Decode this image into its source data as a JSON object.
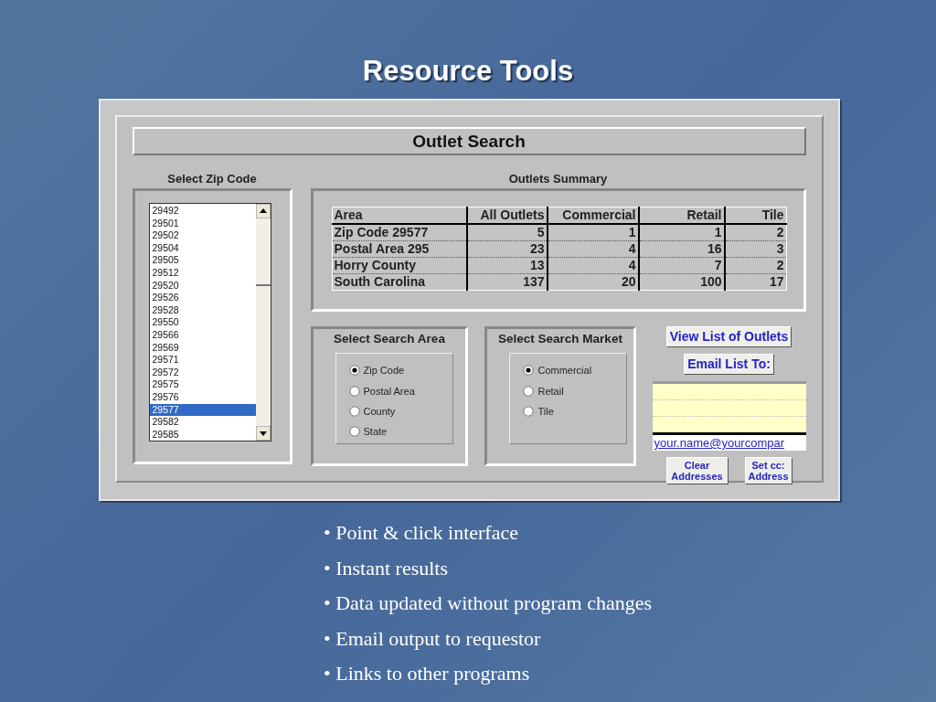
{
  "slide_title": "Resource Tools",
  "form": {
    "title": "Outlet Search",
    "zip_list": {
      "label": "Select Zip Code",
      "items": [
        {
          "text": "29492",
          "selected": false
        },
        {
          "text": "29501",
          "selected": false
        },
        {
          "text": "29502",
          "selected": false
        },
        {
          "text": "29504",
          "selected": false
        },
        {
          "text": "29505",
          "selected": false
        },
        {
          "text": "29512",
          "selected": false
        },
        {
          "text": "29520",
          "selected": false
        },
        {
          "text": "29526",
          "selected": false
        },
        {
          "text": "29528",
          "selected": false
        },
        {
          "text": "29550",
          "selected": false
        },
        {
          "text": "29566",
          "selected": false
        },
        {
          "text": "29569",
          "selected": false
        },
        {
          "text": "29571",
          "selected": false
        },
        {
          "text": "29572",
          "selected": false
        },
        {
          "text": "29575",
          "selected": false
        },
        {
          "text": "29576",
          "selected": false
        },
        {
          "text": "29577",
          "selected": true
        },
        {
          "text": "29582",
          "selected": false
        },
        {
          "text": "29585",
          "selected": false
        }
      ]
    },
    "summary": {
      "label": "Outlets Summary",
      "columns": [
        "Area",
        "All Outlets",
        "Commercial",
        "Retail",
        "Tile"
      ],
      "rows": [
        [
          "Zip Code 29577",
          "5",
          "1",
          "1",
          "2"
        ],
        [
          "Postal Area 295",
          "23",
          "4",
          "16",
          "3"
        ],
        [
          "Horry County",
          "13",
          "4",
          "7",
          "2"
        ],
        [
          "South Carolina",
          "137",
          "20",
          "100",
          "17"
        ]
      ]
    },
    "search_area": {
      "label": "Select Search Area",
      "options": [
        {
          "label": "Zip Code",
          "selected": true
        },
        {
          "label": "Postal Area",
          "selected": false
        },
        {
          "label": "County",
          "selected": false
        },
        {
          "label": "State",
          "selected": false
        }
      ]
    },
    "search_market": {
      "label": "Select Search Market",
      "options": [
        {
          "label": "Commercial",
          "selected": true
        },
        {
          "label": "Retail",
          "selected": false
        },
        {
          "label": "Tile",
          "selected": false
        }
      ]
    },
    "view_button": "View List of Outlets",
    "email_button": "Email List To:",
    "email_value": "your.name@yourcompar",
    "clear_button": "Clear Addresses",
    "cc_button": "Set cc: Address"
  },
  "bullets": [
    "• Point & click interface",
    "• Instant results",
    "• Data updated without program changes",
    "• Email output to requestor",
    "• Links to other programs"
  ]
}
